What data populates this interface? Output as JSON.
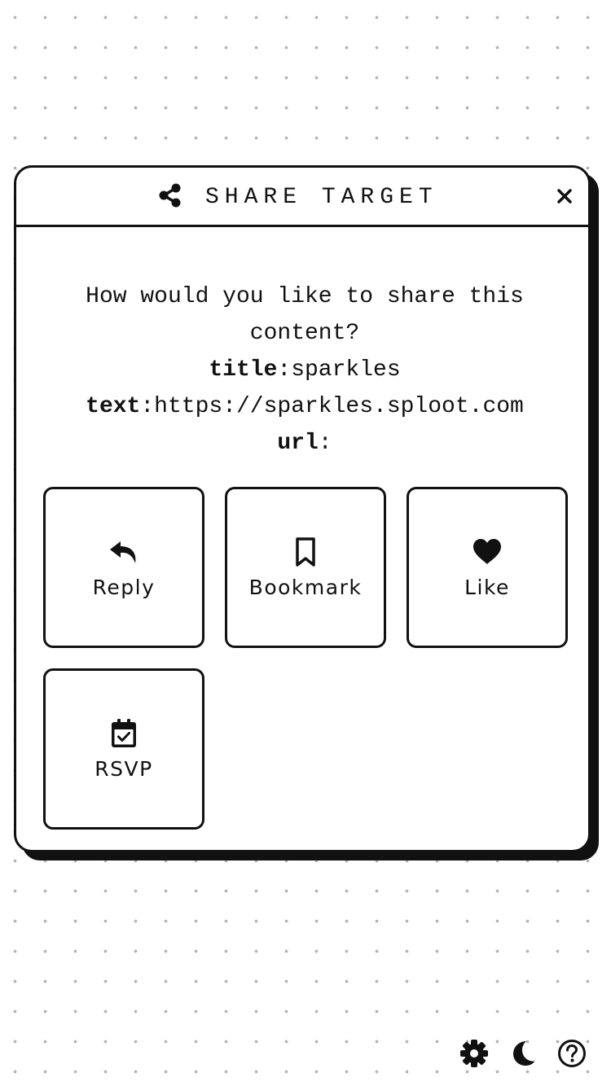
{
  "dialog": {
    "title": "SHARE TARGET",
    "header_icon": "share-nodes-icon",
    "close_icon": "close-icon",
    "close_symbol": "✕"
  },
  "message": {
    "question": "How would you like to share this content?",
    "fields": [
      {
        "label": "title",
        "separator": ":",
        "value": "sparkles"
      },
      {
        "label": "text",
        "separator": ":",
        "value": "https://sparkles.sploot.com"
      },
      {
        "label": "url",
        "separator": ":",
        "value": ""
      }
    ]
  },
  "actions": [
    {
      "label": "Reply",
      "icon": "reply-arrow-icon"
    },
    {
      "label": "Bookmark",
      "icon": "bookmark-icon"
    },
    {
      "label": "Like",
      "icon": "heart-icon"
    },
    {
      "label": "RSVP",
      "icon": "calendar-check-icon"
    }
  ],
  "toolbar": {
    "settings_icon": "gear-icon",
    "theme_icon": "moon-icon",
    "help_icon": "help-circle-icon"
  },
  "colors": {
    "ink": "#111111",
    "background": "#ffffff",
    "dot_grid": "#b4b4b4"
  }
}
